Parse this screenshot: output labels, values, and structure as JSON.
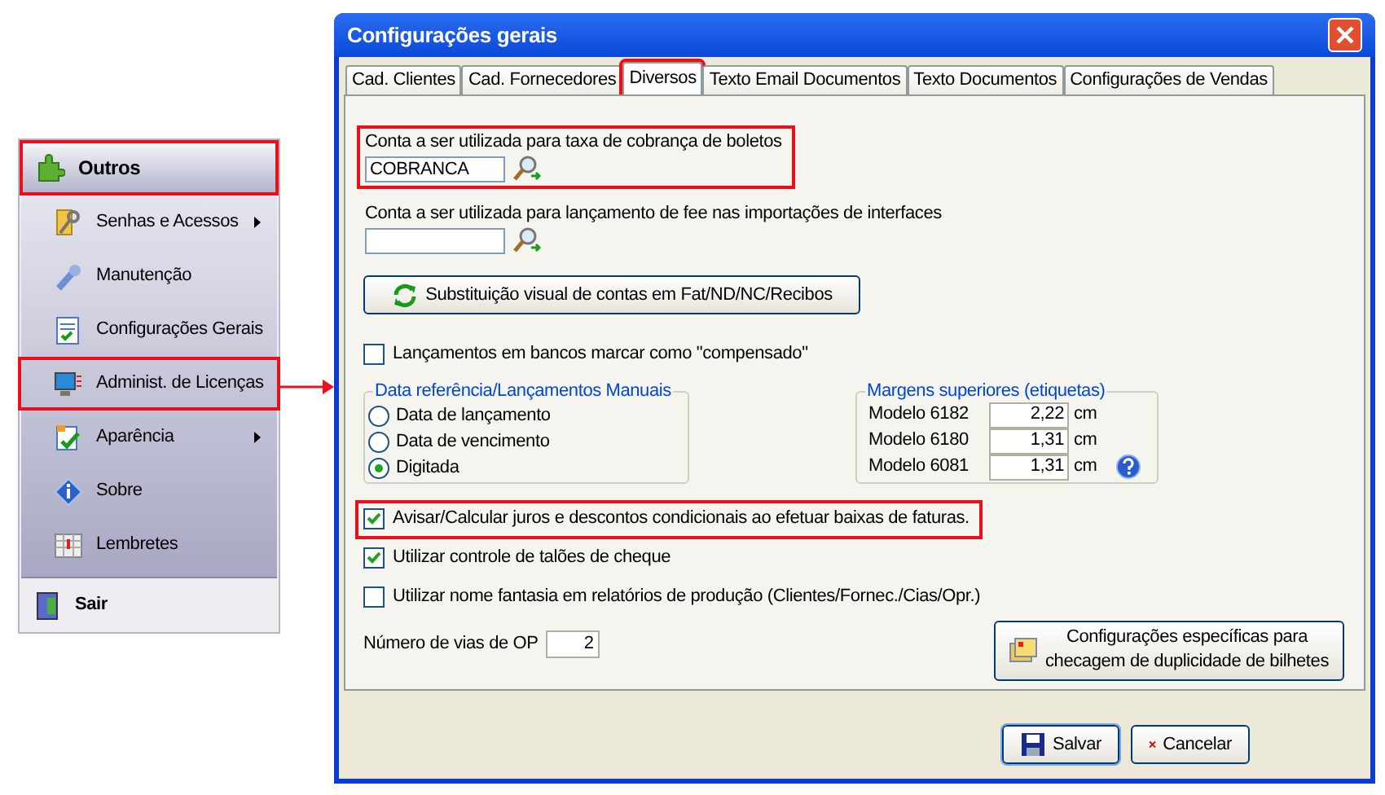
{
  "menu": {
    "header": {
      "label": "Outros",
      "highlighted": true
    },
    "items": [
      {
        "label": "Senhas e Acessos",
        "kind": "key",
        "submenu": true,
        "highlighted": false
      },
      {
        "label": "Manutenção",
        "kind": "wrench",
        "submenu": false,
        "highlighted": false
      },
      {
        "label": "Configurações Gerais",
        "kind": "checklist",
        "submenu": false,
        "highlighted": false
      },
      {
        "label": "Administ. de Licenças",
        "kind": "monitor",
        "submenu": false,
        "highlighted": true
      },
      {
        "label": "Aparência",
        "kind": "paint",
        "submenu": true,
        "highlighted": false
      },
      {
        "label": "Sobre",
        "kind": "info",
        "submenu": false,
        "highlighted": false
      },
      {
        "label": "Lembretes",
        "kind": "calendar",
        "submenu": false,
        "highlighted": false
      }
    ],
    "footer": {
      "label": "Sair"
    }
  },
  "dialog": {
    "title": "Configurações gerais",
    "tabs": [
      {
        "label": "Cad. Clientes",
        "selected": false,
        "highlighted": false
      },
      {
        "label": "Cad. Fornecedores",
        "selected": false,
        "highlighted": false
      },
      {
        "label": "Diversos",
        "selected": true,
        "highlighted": true
      },
      {
        "label": "Texto Email Documentos",
        "selected": false,
        "highlighted": false
      },
      {
        "label": "Texto Documentos",
        "selected": false,
        "highlighted": false
      },
      {
        "label": "Configurações de Vendas",
        "selected": false,
        "highlighted": false
      }
    ],
    "account_fields": [
      {
        "label": "Conta a ser utilizada para taxa de cobrança de boletos",
        "value": "COBRANCA",
        "highlighted": true
      },
      {
        "label": "Conta a ser utilizada para lançamento de fee nas importações de interfaces",
        "highlighted": false
      }
    ],
    "replace_button": "Substituição visual de contas em Fat/ND/NC/Recibos",
    "compensado": {
      "label": "Lançamentos em bancos marcar como \"compensado\"",
      "checked": false
    },
    "date_group": {
      "title": "Data referência/Lançamentos Manuais",
      "options": [
        {
          "label": "Data de lançamento",
          "selected": false
        },
        {
          "label": "Data de vencimento",
          "selected": false
        },
        {
          "label": "Digitada",
          "selected": true
        }
      ]
    },
    "margins_group": {
      "title": "Margens superiores (etiquetas)",
      "rows": [
        {
          "label": "Modelo 6182",
          "value": "2,22",
          "unit": "cm"
        },
        {
          "label": "Modelo 6180",
          "value": "1,31",
          "unit": "cm"
        },
        {
          "label": "Modelo 6081",
          "value": "1,31",
          "unit": "cm"
        }
      ]
    },
    "options": [
      {
        "label": "Avisar/Calcular juros e descontos condicionais ao efetuar baixas de faturas.",
        "checked": true,
        "highlighted": true
      },
      {
        "label": "Utilizar controle de talões de cheque",
        "checked": true,
        "highlighted": false
      },
      {
        "label": "Utilizar nome fantasia em relatórios de produção (Clientes/Fornec./Cias/Opr.)",
        "checked": false,
        "highlighted": false
      }
    ],
    "copies": {
      "label": "Número de vias de OP",
      "value": "2"
    },
    "duplicate_button": {
      "line1": "Configurações específicas para",
      "line2": "checagem de duplicidade de bilhetes"
    },
    "buttons": [
      {
        "label": "Salvar",
        "kind": "save"
      },
      {
        "label": "Cancelar",
        "kind": "cancel"
      }
    ]
  }
}
